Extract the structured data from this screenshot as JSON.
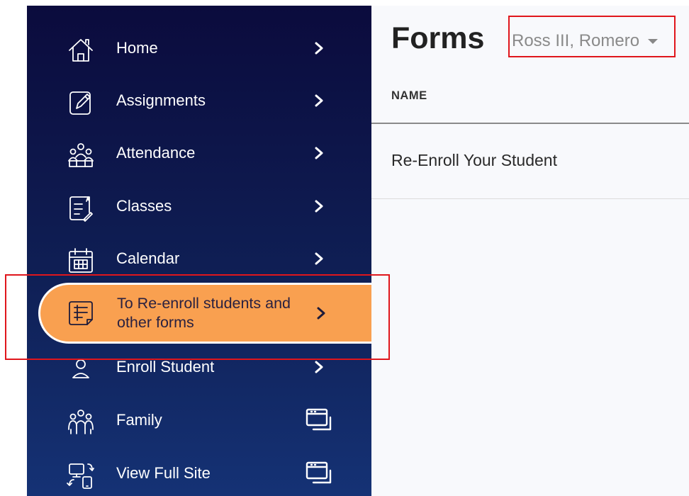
{
  "sidebar": {
    "items": [
      {
        "label": "Home",
        "icon": "home-icon",
        "indicator": "chevron"
      },
      {
        "label": "Assignments",
        "icon": "edit-document-icon",
        "indicator": "chevron"
      },
      {
        "label": "Attendance",
        "icon": "group-attendance-icon",
        "indicator": "chevron"
      },
      {
        "label": "Classes",
        "icon": "class-document-icon",
        "indicator": "chevron"
      },
      {
        "label": "Calendar",
        "icon": "calendar-icon",
        "indicator": "chevron"
      },
      {
        "label": "To Re-enroll students and other forms",
        "icon": "form-list-icon",
        "indicator": "chevron",
        "active": true
      },
      {
        "label": "Enroll Student",
        "icon": "person-icon",
        "indicator": "chevron"
      },
      {
        "label": "Family",
        "icon": "family-icon",
        "indicator": "external-window"
      },
      {
        "label": "View Full Site",
        "icon": "devices-switch-icon",
        "indicator": "external-window"
      }
    ]
  },
  "main": {
    "title": "Forms",
    "student_selector": {
      "value": "Ross III, Romero"
    },
    "table": {
      "columns": [
        "NAME"
      ],
      "rows": [
        [
          "Re-Enroll Your Student"
        ]
      ]
    }
  },
  "colors": {
    "sidebar_top": "#0b0b3d",
    "sidebar_bottom": "#153275",
    "active_item": "#f9a050",
    "highlight_box": "#e0161c",
    "main_background": "#f8f9fc"
  }
}
